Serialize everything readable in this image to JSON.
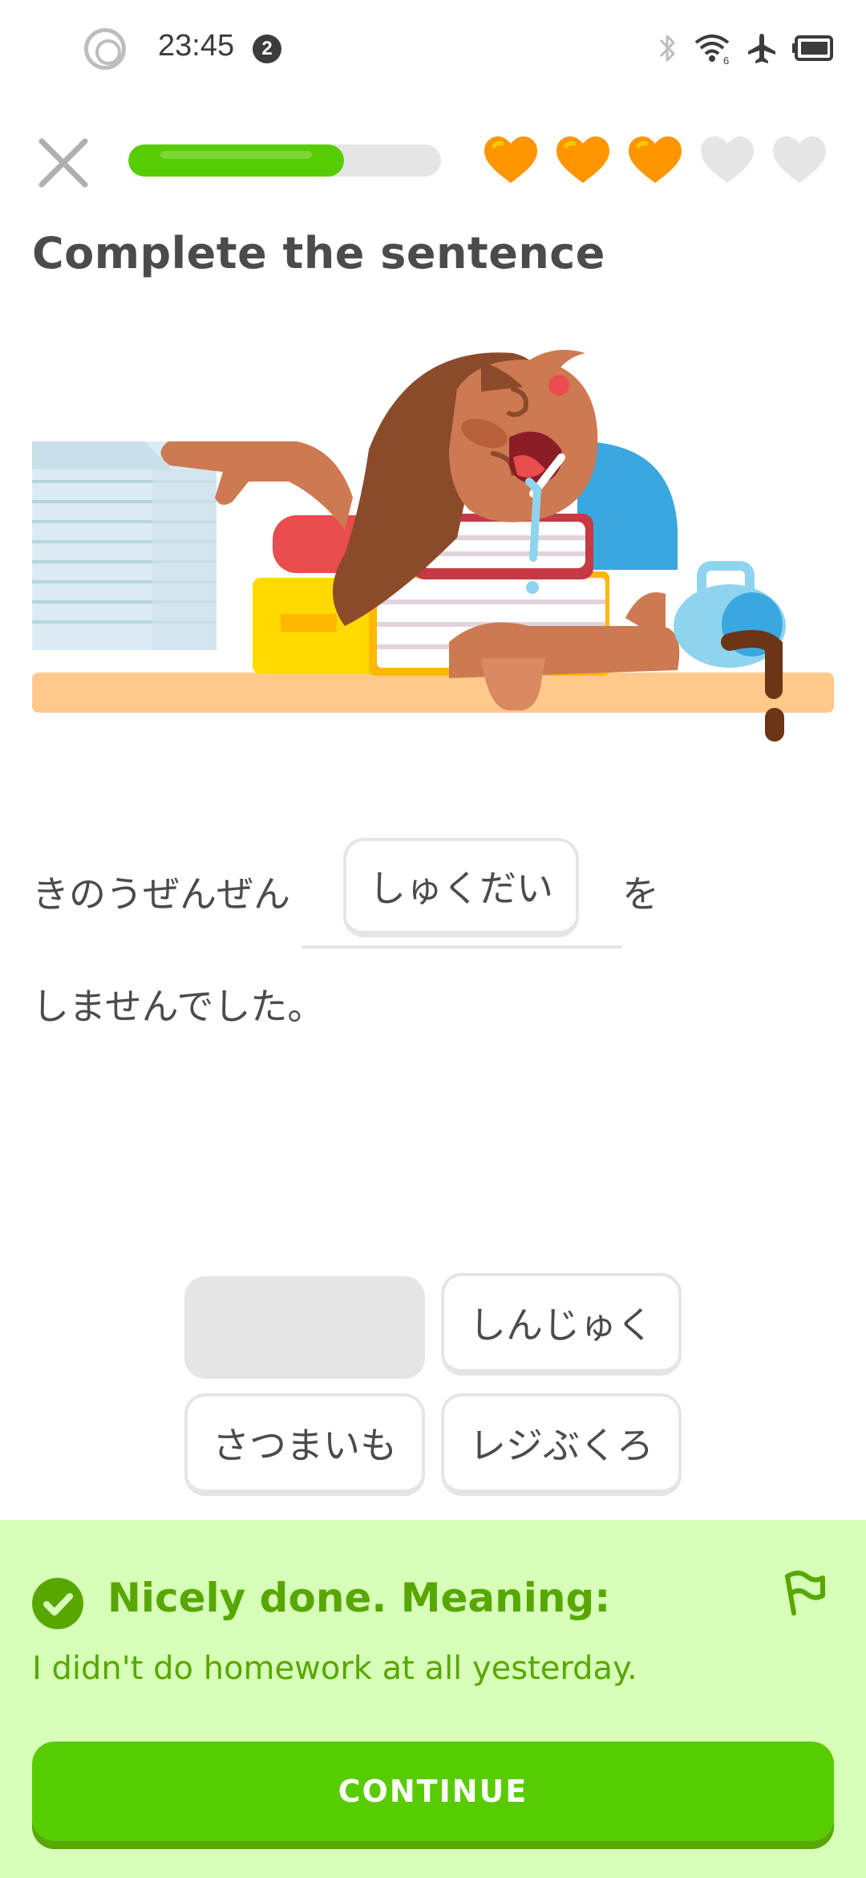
{
  "status_bar": {
    "time": "23:45",
    "notification_count": "2",
    "wifi_label": "6"
  },
  "lesson": {
    "progress": 0.69,
    "hearts_total": 5,
    "hearts_filled": 3,
    "heart_color": "#ff9600",
    "heart_empty_color": "#e5e5e5",
    "accent_color": "#58cc02"
  },
  "instruction": "Complete the sentence",
  "sentence": {
    "prefix": "きのうぜんぜん",
    "answer": "しゅくだい",
    "particle": "を",
    "line2": "しませんでした。"
  },
  "word_bank": [
    {
      "label": "",
      "used": true
    },
    {
      "label": "しんじゅく",
      "used": false
    },
    {
      "label": "さつまいも",
      "used": false
    },
    {
      "label": "レジぶくろ",
      "used": false
    }
  ],
  "feedback": {
    "title": "Nicely done. Meaning:",
    "meaning": "I didn't do homework at all yesterday.",
    "continue_label": "CONTINUE",
    "background": "#d7ffb8",
    "text_color": "#58a700"
  }
}
